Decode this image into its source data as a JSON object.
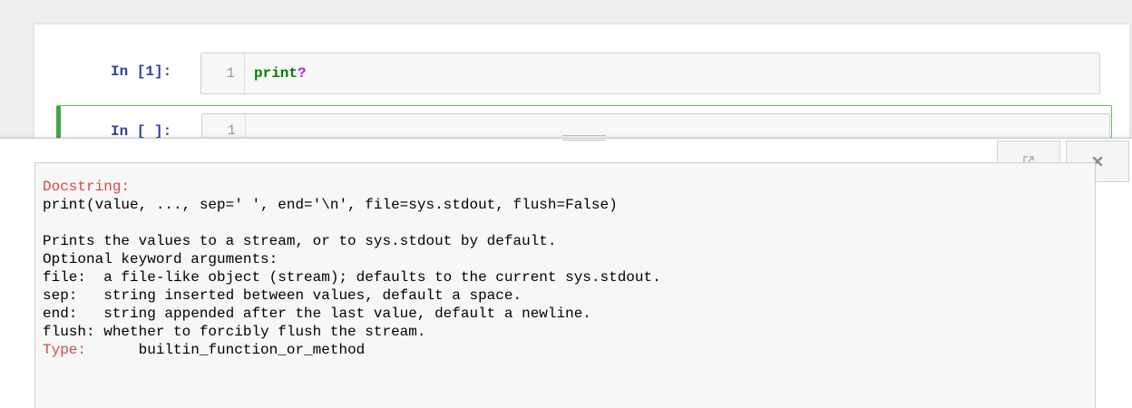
{
  "cells": [
    {
      "prompt": "In [1]:",
      "line_number": "1",
      "code_name": "print",
      "code_op": "?"
    },
    {
      "prompt": "In [ ]:",
      "line_number": "1",
      "code_name": "",
      "code_op": ""
    }
  ],
  "pager": {
    "expand_icon": "external-link-icon",
    "close_icon": "close-icon",
    "docstring_label": "Docstring:",
    "signature": "print(value, ..., sep=' ', end='\\n', file=sys.stdout, flush=False)",
    "blank": "",
    "lines": [
      "Prints the values to a stream, or to sys.stdout by default.",
      "Optional keyword arguments:",
      "file:  a file-like object (stream); defaults to the current sys.stdout.",
      "sep:   string inserted between values, default a space.",
      "end:   string appended after the last value, default a newline.",
      "flush: whether to forcibly flush the stream."
    ],
    "type_label": "Type:",
    "type_value": "      builtin_function_or_method"
  },
  "colors": {
    "prompt": "#303f9f",
    "keyword": "#008000",
    "operator": "#aa22ff",
    "doc_label": "#d94747",
    "selected_cell_border": "#42a545"
  }
}
